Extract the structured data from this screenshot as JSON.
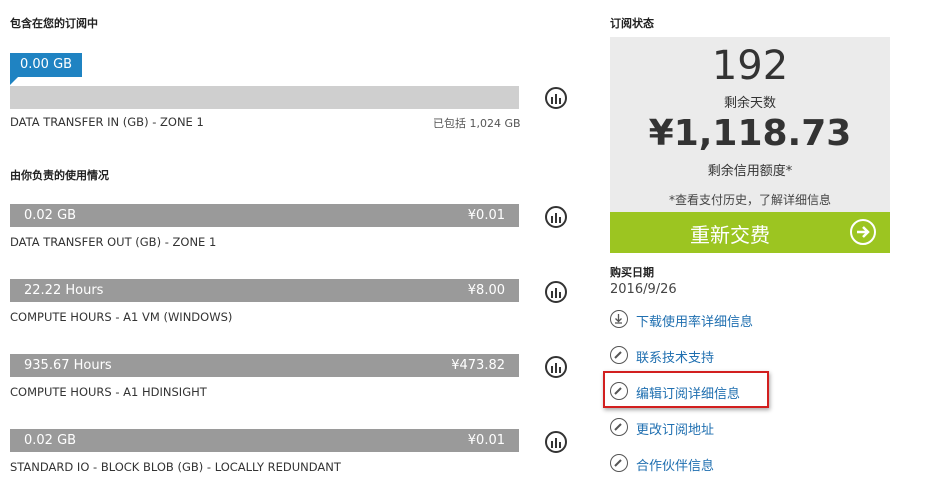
{
  "included": {
    "title": "包含在您的订阅中",
    "tooltip": "0.00 GB",
    "item_label": "DATA TRANSFER IN (GB) - ZONE 1",
    "included_note": "已包括 1,024 GB"
  },
  "usage": {
    "title": "由你负责的使用情况",
    "items": [
      {
        "amount": "0.02 GB",
        "cost": "¥0.01",
        "label": "DATA TRANSFER OUT (GB) - ZONE 1"
      },
      {
        "amount": "22.22 Hours",
        "cost": "¥8.00",
        "label": "COMPUTE HOURS - A1 VM (WINDOWS)"
      },
      {
        "amount": "935.67 Hours",
        "cost": "¥473.82",
        "label": "COMPUTE HOURS - A1 HDINSIGHT"
      },
      {
        "amount": "0.02 GB",
        "cost": "¥0.01",
        "label": "STANDARD IO - BLOCK BLOB (GB) - LOCALLY REDUNDANT"
      }
    ]
  },
  "status": {
    "title": "订阅状态",
    "days_value": "192",
    "days_label": "剩余天数",
    "credit_value": "¥1,118.73",
    "credit_label": "剩余信用额度*",
    "note": "*查看支付历史，了解详细信息",
    "renew_label": "重新交费"
  },
  "purchase": {
    "title": "购买日期",
    "date": "2016/9/26"
  },
  "links": [
    {
      "label": "下载使用率详细信息",
      "icon": "download-icon"
    },
    {
      "label": "联系技术支持",
      "icon": "pencil-icon"
    },
    {
      "label": "编辑订阅详细信息",
      "icon": "pencil-icon"
    },
    {
      "label": "更改订阅地址",
      "icon": "pencil-icon"
    },
    {
      "label": "合作伙伴信息",
      "icon": "pencil-icon"
    }
  ],
  "colors": {
    "accent_blue": "#1f83c2",
    "renew_green": "#9cc521",
    "link_blue": "#1f6fb0",
    "highlight_red": "#d21f1f",
    "bar_gray": "#9a9a9a"
  }
}
